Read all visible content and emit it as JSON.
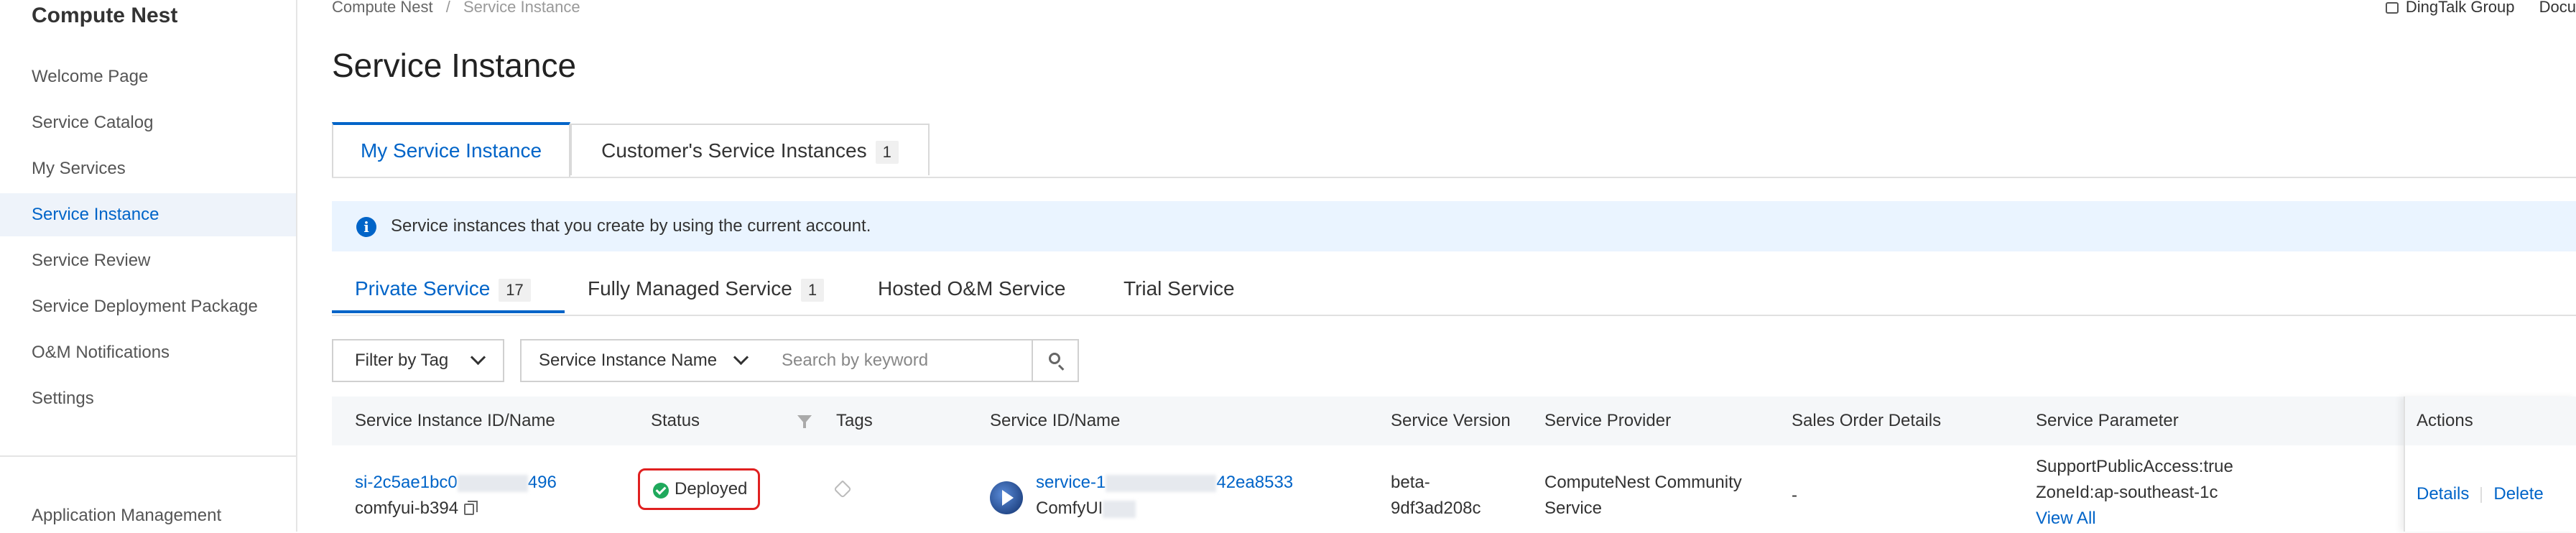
{
  "sidebar": {
    "title": "Compute Nest",
    "items": [
      {
        "label": "Welcome Page"
      },
      {
        "label": "Service Catalog"
      },
      {
        "label": "My Services"
      },
      {
        "label": "Service Instance"
      },
      {
        "label": "Service Review"
      },
      {
        "label": "Service Deployment Package"
      },
      {
        "label": "O&M Notifications"
      },
      {
        "label": "Settings"
      }
    ],
    "bottom_item": "Application Management"
  },
  "breadcrumb": {
    "root": "Compute Nest",
    "separator": "/",
    "current": "Service Instance"
  },
  "topbar": {
    "dingtalk": "DingTalk Group",
    "docs": "Docu"
  },
  "page_title": "Service Instance",
  "main_tabs": [
    {
      "label": "My Service Instance"
    },
    {
      "label": "Customer's Service Instances",
      "count": "1"
    }
  ],
  "info_message": "Service instances that you create by using the current account.",
  "sub_tabs": [
    {
      "label": "Private Service",
      "count": "17"
    },
    {
      "label": "Fully Managed Service",
      "count": "1"
    },
    {
      "label": "Hosted O&M Service"
    },
    {
      "label": "Trial Service"
    }
  ],
  "filters": {
    "tag_filter": "Filter by Tag",
    "field_select": "Service Instance Name",
    "search_placeholder": "Search by keyword"
  },
  "table": {
    "columns": [
      "Service Instance ID/Name",
      "Status",
      "Tags",
      "Service ID/Name",
      "Service Version",
      "Service Provider",
      "Sales Order Details",
      "Service Parameter",
      "Actions"
    ],
    "rows": [
      {
        "instance_id_start": "si-2c5ae1bc0",
        "instance_id_end": "496",
        "instance_name": "comfyui-b394",
        "status": "Deployed",
        "service_id_start": "service-1",
        "service_id_end": "42ea8533",
        "service_name": "ComfyUI",
        "version_line1": "beta-",
        "version_line2": "9df3ad208c",
        "provider_line1": "ComputeNest Community",
        "provider_line2": "Service",
        "sales_order": "-",
        "param_line1": "SupportPublicAccess:true",
        "param_line2": "ZoneId:ap-southeast-1c",
        "param_link": "View All",
        "action_details": "Details",
        "action_delete": "Delete"
      }
    ]
  },
  "colors": {
    "accent": "#0064c8",
    "active_bg": "#eef3fa",
    "info_bg": "#eaf4ff",
    "success": "#1fa95c",
    "highlight": "#e02020"
  }
}
